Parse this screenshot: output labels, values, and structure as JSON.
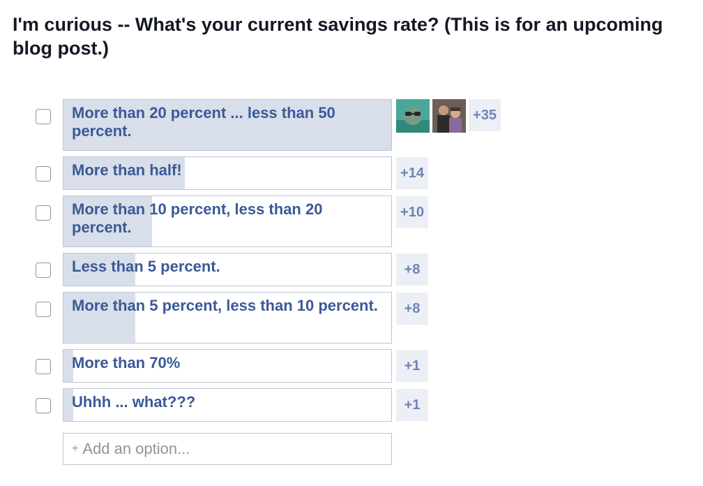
{
  "poll": {
    "question": "I'm curious -- What's your current savings rate? (This is for an upcoming blog post.)",
    "options": [
      {
        "label": "More than 20 percent ... less than 50 percent.",
        "count": "+35",
        "share": 1.0,
        "avatars": true
      },
      {
        "label": "More than half!",
        "count": "+14",
        "share": 0.37
      },
      {
        "label": "More than 10 percent, less than 20 percent.",
        "count": "+10",
        "share": 0.27
      },
      {
        "label": "Less than 5 percent.",
        "count": "+8",
        "share": 0.22
      },
      {
        "label": "More than 5 percent, less than 10 percent.",
        "count": "+8",
        "share": 0.22
      },
      {
        "label": "More than 70%",
        "count": "+1",
        "share": 0.03
      },
      {
        "label": "Uhhh ... what???",
        "count": "+1",
        "share": 0.03
      }
    ],
    "add_option_placeholder": "Add an option..."
  },
  "colors": {
    "bar_fill": "#d8dfea",
    "link_blue": "#3b5998",
    "count_bg": "#eceff5"
  },
  "icons": {
    "add": "plus-icon"
  }
}
